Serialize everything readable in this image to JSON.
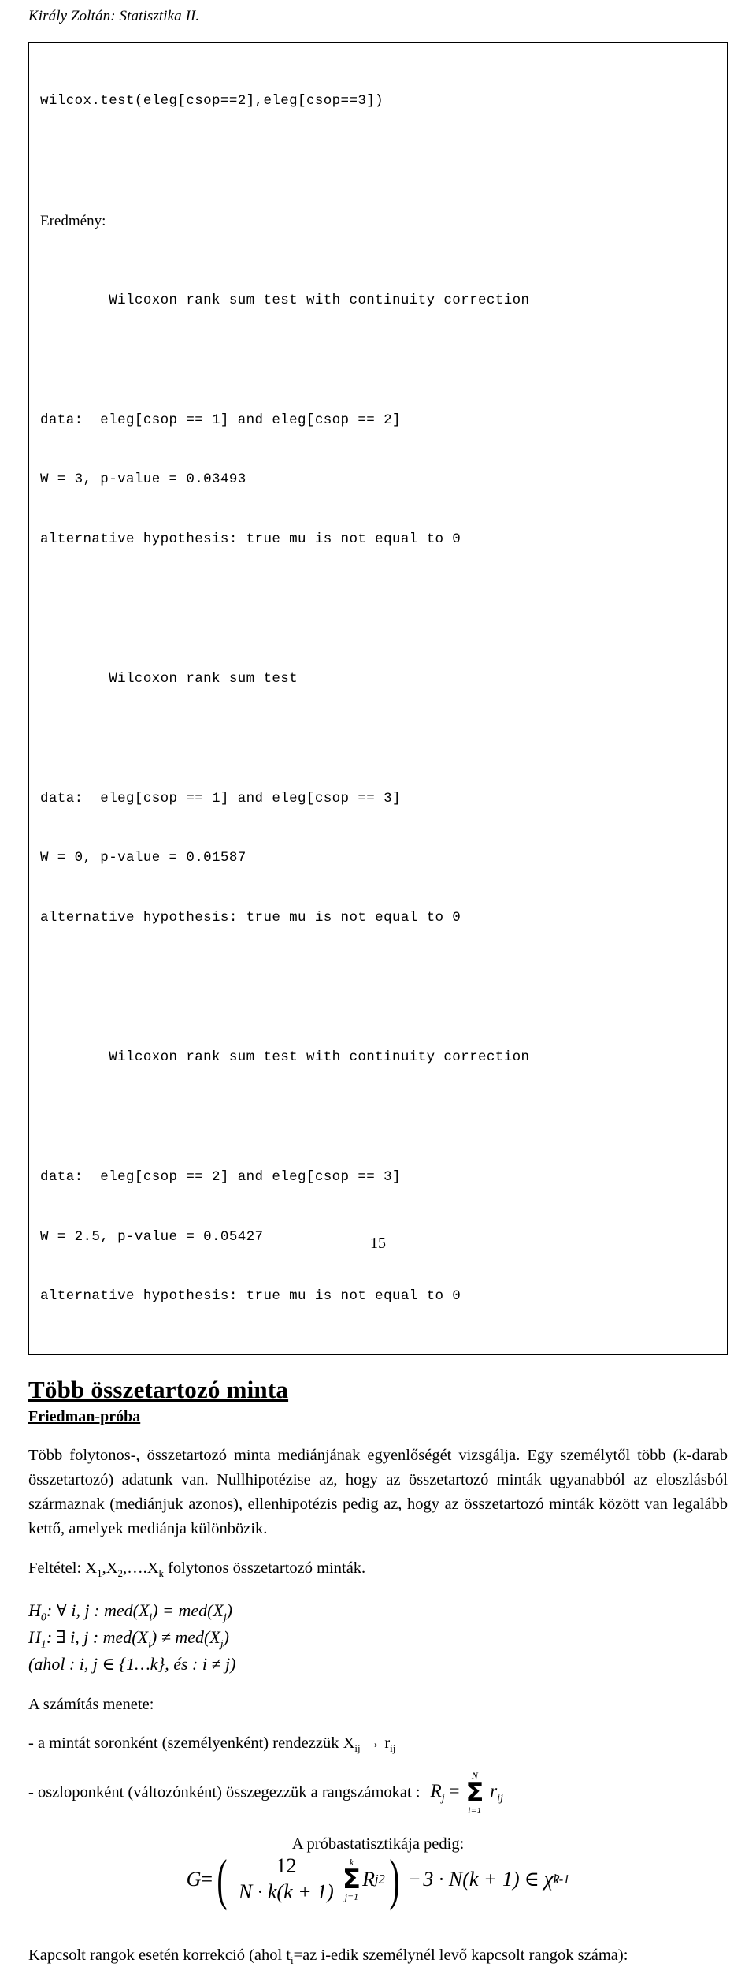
{
  "header": {
    "running_title": "Király Zoltán: Statisztika II."
  },
  "code_box": {
    "command": "wilcox.test(eleg[csop==2],eleg[csop==3])",
    "result_label": "Eredmény:",
    "blocks": [
      {
        "title": "        Wilcoxon rank sum test with continuity correction",
        "data": "data:  eleg[csop == 1] and eleg[csop == 2]",
        "stat": "W = 3, p-value = 0.03493",
        "alt": "alternative hypothesis: true mu is not equal to 0"
      },
      {
        "title": "        Wilcoxon rank sum test",
        "data": "data:  eleg[csop == 1] and eleg[csop == 3]",
        "stat": "W = 0, p-value = 0.01587",
        "alt": "alternative hypothesis: true mu is not equal to 0"
      },
      {
        "title": "        Wilcoxon rank sum test with continuity correction",
        "data": "data:  eleg[csop == 2] and eleg[csop == 3]",
        "stat": "W = 2.5, p-value = 0.05427",
        "alt": "alternative hypothesis: true mu is not equal to 0"
      }
    ]
  },
  "section": {
    "title": "Több összetartozó minta",
    "subtitle": "Friedman-próba",
    "intro": "Több folytonos-, összetartozó minta mediánjának egyenlőségét vizsgálja. Egy személytől több (k-darab összetartozó) adatunk van. Nullhipotézise az, hogy az összetartozó minták ugyanabból az eloszlásból származnak (mediánjuk azonos), ellenhipotézis pedig az, hogy az összetartozó minták között van legalább kettő, amelyek mediánja különbözik.",
    "condition_prefix": "Feltétel: X",
    "condition_sub1": "1",
    "condition_mid1": ",X",
    "condition_sub2": "2",
    "condition_mid2": ",….X",
    "condition_sub3": "k",
    "condition_suffix": " folytonos összetartozó minták."
  },
  "hypotheses": {
    "h0_name": "H",
    "h0_sub": "0",
    "h0_body": ": ∀ i, j : med(X",
    "h0_sub_i": "i",
    "h0_mid": ") = med(X",
    "h0_sub_j": "j",
    "h0_end": ")",
    "h1_name": "H",
    "h1_sub": "1",
    "h1_body": ": ∃ i, j : med(X",
    "h1_sub_i": "i",
    "h1_mid": ") ≠ med(X",
    "h1_sub_j": "j",
    "h1_end": ")",
    "domain_note": "(ahol : i, j ∈ {1…k}, és : i ≠ j)"
  },
  "method": {
    "heading": "A számítás menete:",
    "step1_prefix": "- a mintát soronként (személyenként) rendezzük X",
    "step1_sub1": "ij",
    "step1_arrow": "→",
    "step1_r": " r",
    "step1_sub2": "ij",
    "step2_text": "- oszloponként (változónként) összegezzük a rangszámokat :",
    "step2_R": "R",
    "step2_R_sub": "j",
    "step2_eq": "=",
    "step2_sum_upper": "N",
    "step2_sum_lower": "i=1",
    "step2_r": "r",
    "step2_r_sub": "ij"
  },
  "statistic": {
    "caption": "A próbastatisztikája pedig:",
    "G": "G",
    "eq": "=",
    "numerator": "12",
    "denominator": "N · k(k + 1)",
    "sum_upper": "k",
    "sum_lower": "j=1",
    "sum_term": "R",
    "sum_term_sub": "j",
    "sum_term_sup": "2",
    "minus": "−",
    "tail": "3 · N(k + 1)",
    "elem": "∈",
    "chi": "χ",
    "chi_sup": "2",
    "chi_sub": "k-1"
  },
  "footer_note": {
    "text_prefix": "Kapcsolt rangok esetén korrekció (ahol t",
    "sub": "i",
    "text_suffix": "=az i-edik személynél levő kapcsolt rangok száma):"
  },
  "page": {
    "number": "15"
  }
}
